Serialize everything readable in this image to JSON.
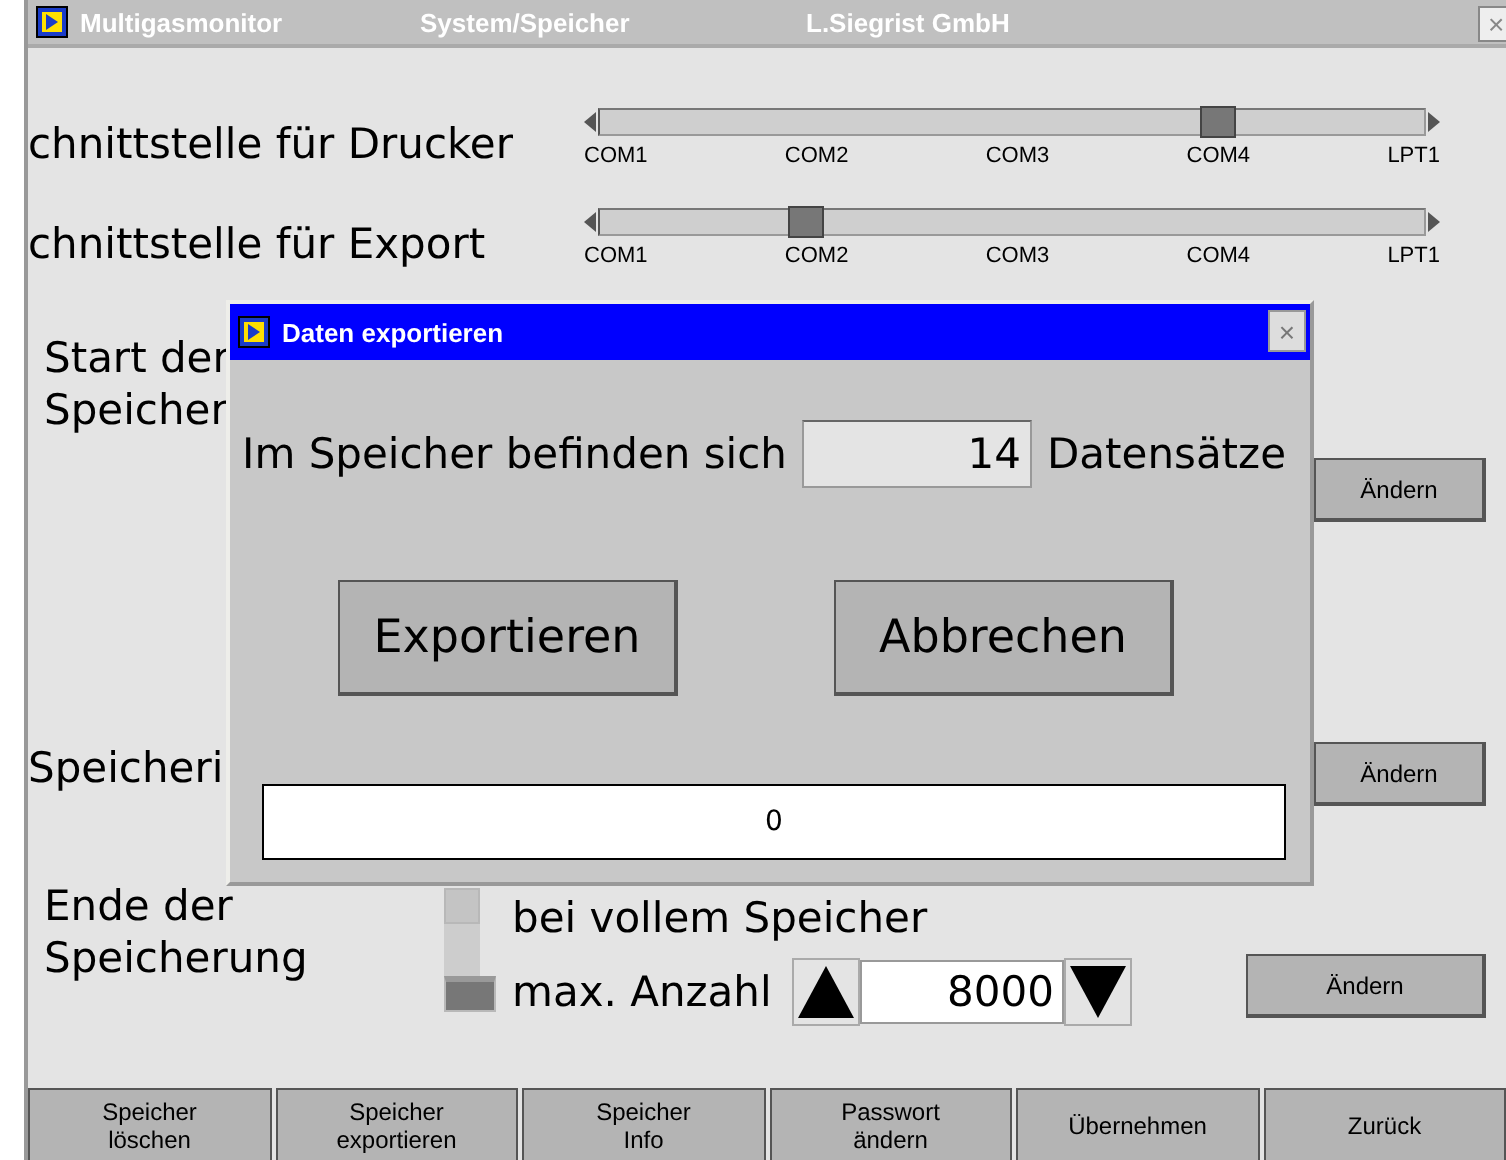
{
  "window": {
    "title_parts": [
      "Multigasmonitor",
      "System/Speicher",
      "L.Siegrist GmbH"
    ],
    "close": "×"
  },
  "ports": [
    {
      "label": "chnittstelle für Drucker",
      "ticks": [
        "COM1",
        "COM2",
        "COM3",
        "COM4",
        "LPT1"
      ],
      "level": 0.75
    },
    {
      "label": "chnittstelle für Export",
      "ticks": [
        "COM1",
        "COM2",
        "COM3",
        "COM4",
        "LPT1"
      ],
      "level": 0.25
    }
  ],
  "start_section": {
    "label_lines": [
      "Start der",
      "Speicher"
    ],
    "button": "Ändern"
  },
  "interval_section": {
    "label": "Speicheri",
    "button": "Ändern"
  },
  "end_section": {
    "label_lines": [
      "Ende der",
      "Speicherung"
    ],
    "options": [
      {
        "label": "bei vollem Speicher",
        "selected": false
      },
      {
        "label": "max. Anzahl",
        "selected": true
      }
    ],
    "count": "8000",
    "button": "Ändern"
  },
  "toolbar": [
    {
      "lines": [
        "Speicher",
        "löschen"
      ]
    },
    {
      "lines": [
        "Speicher",
        "exportieren"
      ]
    },
    {
      "lines": [
        "Speicher",
        "Info"
      ]
    },
    {
      "lines": [
        "Passwort",
        "ändern"
      ]
    },
    {
      "lines": [
        "Übernehmen"
      ]
    },
    {
      "lines": [
        "Zurück"
      ]
    }
  ],
  "dialog": {
    "title": "Daten exportieren",
    "close": "×",
    "prefix": "Im Speicher befinden sich",
    "count": "14",
    "suffix": "Datensätze",
    "buttons": [
      "Exportieren",
      "Abbrechen"
    ],
    "progress_text": "0"
  }
}
